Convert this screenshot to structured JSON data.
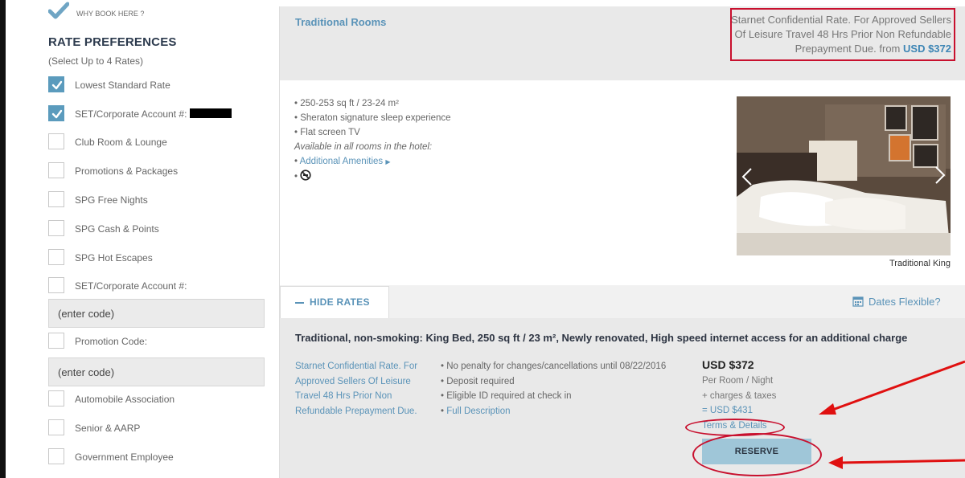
{
  "sidebar": {
    "why_book_label": "WHY BOOK HERE ?",
    "title": "RATE PREFERENCES",
    "subtitle": "(Select Up to 4 Rates)",
    "options": [
      {
        "label": "Lowest Standard Rate",
        "checked": true
      },
      {
        "label": "SET/Corporate Account #:",
        "checked": true
      },
      {
        "label": "Club Room & Lounge",
        "checked": false
      },
      {
        "label": "Promotions & Packages",
        "checked": false
      },
      {
        "label": "SPG Free Nights",
        "checked": false
      },
      {
        "label": "SPG Cash & Points",
        "checked": false
      },
      {
        "label": "SPG Hot Escapes",
        "checked": false
      },
      {
        "label": "SET/Corporate Account #:",
        "checked": false
      },
      {
        "label": "Promotion Code:",
        "checked": false
      },
      {
        "label": "Automobile Association",
        "checked": false
      },
      {
        "label": "Senior & AARP",
        "checked": false
      },
      {
        "label": "Government Employee",
        "checked": false
      }
    ],
    "corporate_code_value": "(enter code)",
    "promo_code_value": "(enter code)"
  },
  "room": {
    "title": "Traditional Rooms",
    "rate_summary": "Starnet Confidential Rate. For Approved Sellers Of Leisure Travel 48 Hrs Prior Non Refundable Prepayment Due. from",
    "rate_summary_price": "USD $372",
    "amenities": [
      "250-253 sq ft / 23-24 m²",
      "Sheraton signature sleep experience",
      "Flat screen TV"
    ],
    "available_note": "Available in all rooms in the hotel:",
    "additional_amenities": "Additional Amenities",
    "photo_caption": "Traditional King"
  },
  "rates": {
    "hide_rates_label": "HIDE RATES",
    "dates_flexible_label": "Dates Flexible?",
    "description": "Traditional, non-smoking: King Bed, 250 sq ft / 23 m², Newly renovated, High speed internet access for an additional charge",
    "rate_name": "Starnet Confidential Rate. For Approved Sellers Of Leisure Travel 48 Hrs Prior Non Refundable Prepayment Due.",
    "policies": [
      "No penalty for changes/cancellations until 08/22/2016",
      "Deposit required",
      "Eligible ID required at check in"
    ],
    "full_description": "Full Description",
    "price": "USD $372",
    "per_room": "Per Room / Night",
    "charges": "+ charges & taxes",
    "total": "= USD $431",
    "terms": "Terms & Details",
    "reserve": "RESERVE"
  },
  "colors": {
    "accent": "#5a93b8",
    "checkbox": "#5b9bbd",
    "annotation": "#c8102e",
    "reserve_bg": "#9fc6d8"
  }
}
